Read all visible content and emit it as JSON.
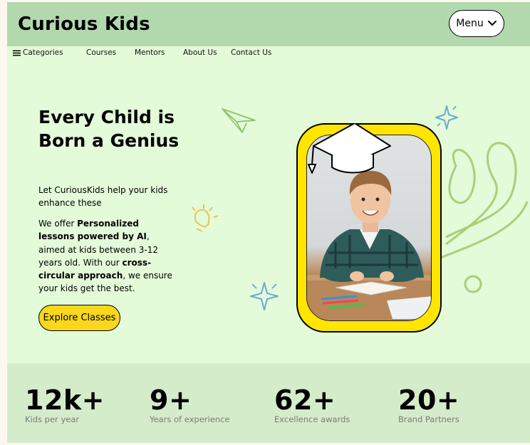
{
  "header": {
    "brand": "Curious Kids",
    "menu_label": "Menu"
  },
  "nav": {
    "categories": "Categories",
    "courses": "Courses",
    "mentors": "Mentors",
    "about": "About Us",
    "contact": "Contact Us"
  },
  "hero": {
    "title": "Every Child is Born a Genius",
    "subtitle": "Let CuriousKids help your kids enhance these",
    "desc_1": "We offer ",
    "desc_bold_1": "Personalized lessons powered by AI",
    "desc_2": ", aimed at kids between 3-12 years old. With our ",
    "desc_bold_2": "cross-circular approach",
    "desc_3": ", we ensure your kids get the best.",
    "cta": "Explore Classes"
  },
  "stats": [
    {
      "value": "12k+",
      "label": "Kids per year"
    },
    {
      "value": "9+",
      "label": "Years of experience"
    },
    {
      "value": "62+",
      "label": "Excellence awards"
    },
    {
      "value": "20+",
      "label": "Brand Partners"
    }
  ],
  "icons": {
    "menu": "chevron-down-icon",
    "categories": "hamburger-icon",
    "paper_plane": "paper-plane-icon",
    "lightbulb": "lightbulb-icon",
    "sparkle": "sparkle-icon",
    "grad_cap": "graduation-cap-icon"
  },
  "colors": {
    "header_bg": "#b2d8ad",
    "page_bg": "#e3fbd8",
    "accent_yellow": "#f8d71c",
    "stats_bg": "#d4ecca"
  }
}
